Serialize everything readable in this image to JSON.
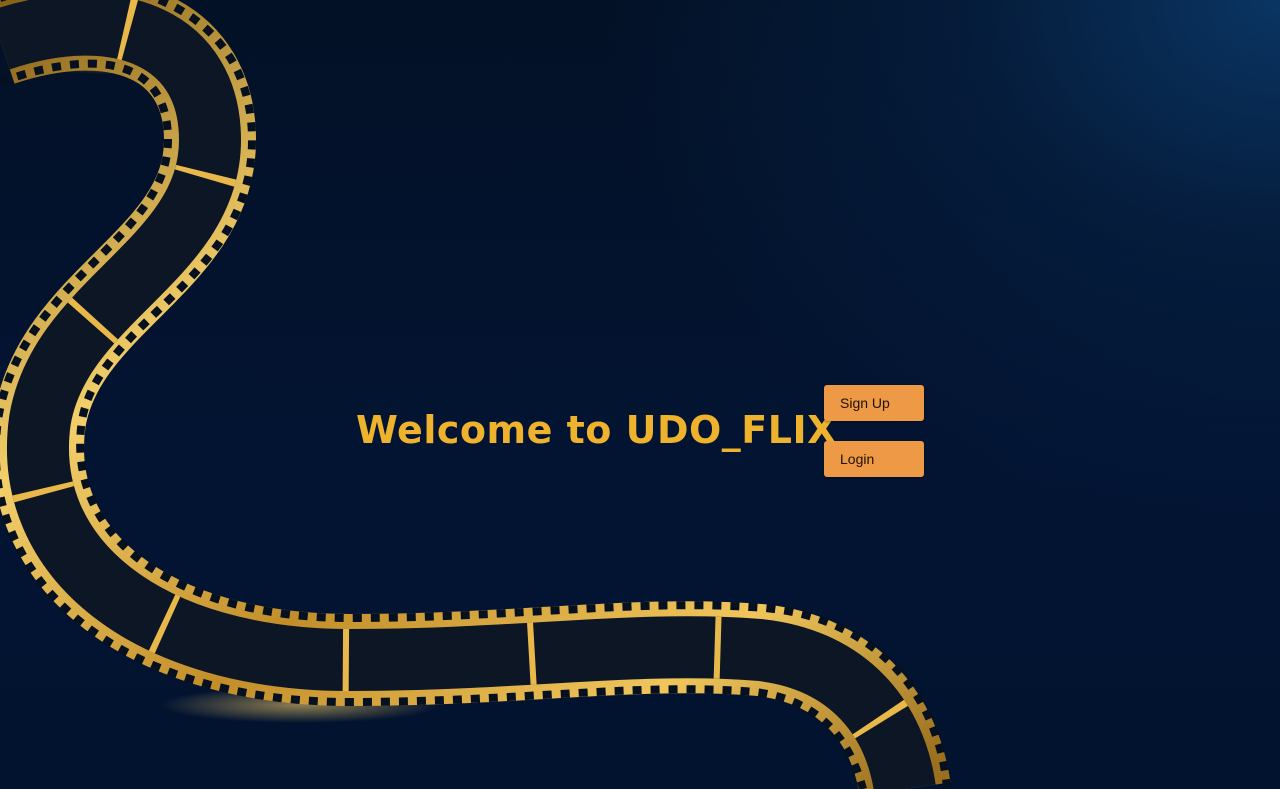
{
  "hero": {
    "title": "Welcome to UDO_FLIX"
  },
  "actions": {
    "signup_label": "Sign Up",
    "login_label": "Login"
  },
  "theme": {
    "background": "#031126",
    "title_color": "#eeb22d",
    "button_color": "#ee9946",
    "film_gold": "#d9a53c"
  }
}
